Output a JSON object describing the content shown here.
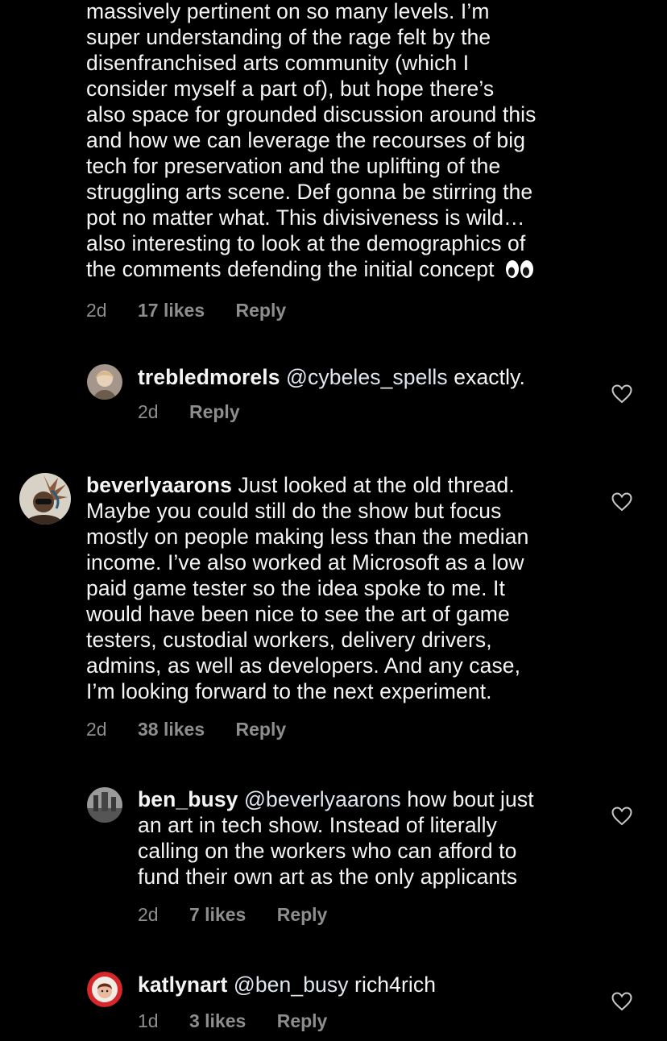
{
  "comments": [
    {
      "id": "c1",
      "text": "massively pertinent on so many levels. I’m super understanding of the rage felt by the disenfranchised arts community (which I consider myself a part of), but hope there’s also space for grounded discussion around this and how we can leverage the recourses of big tech for preservation and the uplifting of the struggling arts scene. Def gonna be stirring the pot no matter what. This divisiveness is wild… also interesting to look at the demographics of the comments defending the initial concept",
      "lines": [
        "massively pertinent on so many levels. I’m",
        "super understanding of the rage felt by the",
        "disenfranchised arts community (which I",
        "consider myself a part of), but hope there’s",
        "also space for grounded discussion around this",
        "and how we can leverage the recourses of big",
        "tech for preservation and the uplifting of the",
        "struggling arts scene. Def gonna be stirring the",
        "pot no matter what. This divisiveness is wild…",
        "also interesting to look at the demographics of",
        "the comments defending the initial concept"
      ],
      "emoji": "eyes",
      "time": "2d",
      "likes": "17 likes",
      "reply": "Reply"
    },
    {
      "id": "c2",
      "username": "trebledmorels",
      "mention": "@cybeles_spells",
      "text": "exactly.",
      "time": "2d",
      "reply": "Reply",
      "icon": "heart-outline"
    },
    {
      "id": "c3",
      "username": "beverlyaarons",
      "lines": [
        "Just looked at the old thread.",
        "Maybe you could still do the show but focus",
        "mostly on people making less than the median",
        "income. I’ve also worked at Microsoft as a low",
        "paid game tester so the idea spoke to me. It",
        "would have been nice to see the art of game",
        "testers, custodial workers, delivery drivers,",
        "admins, as well as developers. And any case,",
        "I’m looking forward to the next experiment."
      ],
      "time": "2d",
      "likes": "38 likes",
      "reply": "Reply",
      "icon": "heart-outline"
    },
    {
      "id": "c4",
      "username": "ben_busy",
      "mention": "@beverlyaarons",
      "lines": [
        "how bout just",
        "an art in tech show. Instead of literally",
        "calling on the workers who can afford to",
        "fund their own art as the only applicants"
      ],
      "time": "2d",
      "likes": "7 likes",
      "reply": "Reply",
      "icon": "heart-outline"
    },
    {
      "id": "c5",
      "username": "katlynart",
      "mention": "@ben_busy",
      "text": "rich4rich",
      "time": "1d",
      "likes": "3 likes",
      "reply": "Reply",
      "icon": "heart-outline"
    }
  ]
}
